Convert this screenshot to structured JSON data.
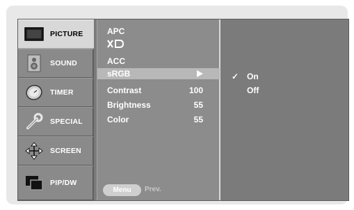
{
  "tabs": [
    {
      "label": "PICTURE",
      "icon": "monitor-icon",
      "active": true
    },
    {
      "label": "SOUND",
      "icon": "speaker-icon",
      "active": false
    },
    {
      "label": "TIMER",
      "icon": "clock-icon",
      "active": false
    },
    {
      "label": "SPECIAL",
      "icon": "wrench-icon",
      "active": false
    },
    {
      "label": "SCREEN",
      "icon": "move-arrows-icon",
      "active": false
    },
    {
      "label": "PIP/DW",
      "icon": "pip-icon",
      "active": false
    }
  ],
  "menu": {
    "items": [
      {
        "name": "APC",
        "value": ""
      },
      {
        "name": "ACC",
        "value": ""
      },
      {
        "name": "sRGB",
        "value": ""
      },
      {
        "name": "Contrast",
        "value": "100"
      },
      {
        "name": "Brightness",
        "value": "55"
      },
      {
        "name": "Color",
        "value": "55"
      }
    ],
    "logo_text": "XD",
    "selected": "sRGB",
    "menu_button": "Menu",
    "prev_label": "Prev."
  },
  "submenu": {
    "check_mark": "✓",
    "options": [
      "On",
      "Off"
    ],
    "checked": "On"
  },
  "colors": {
    "osd_bg": "#7b7b7b",
    "active_tab": "#d8d8d8",
    "highlight": "#b8b8b8"
  }
}
